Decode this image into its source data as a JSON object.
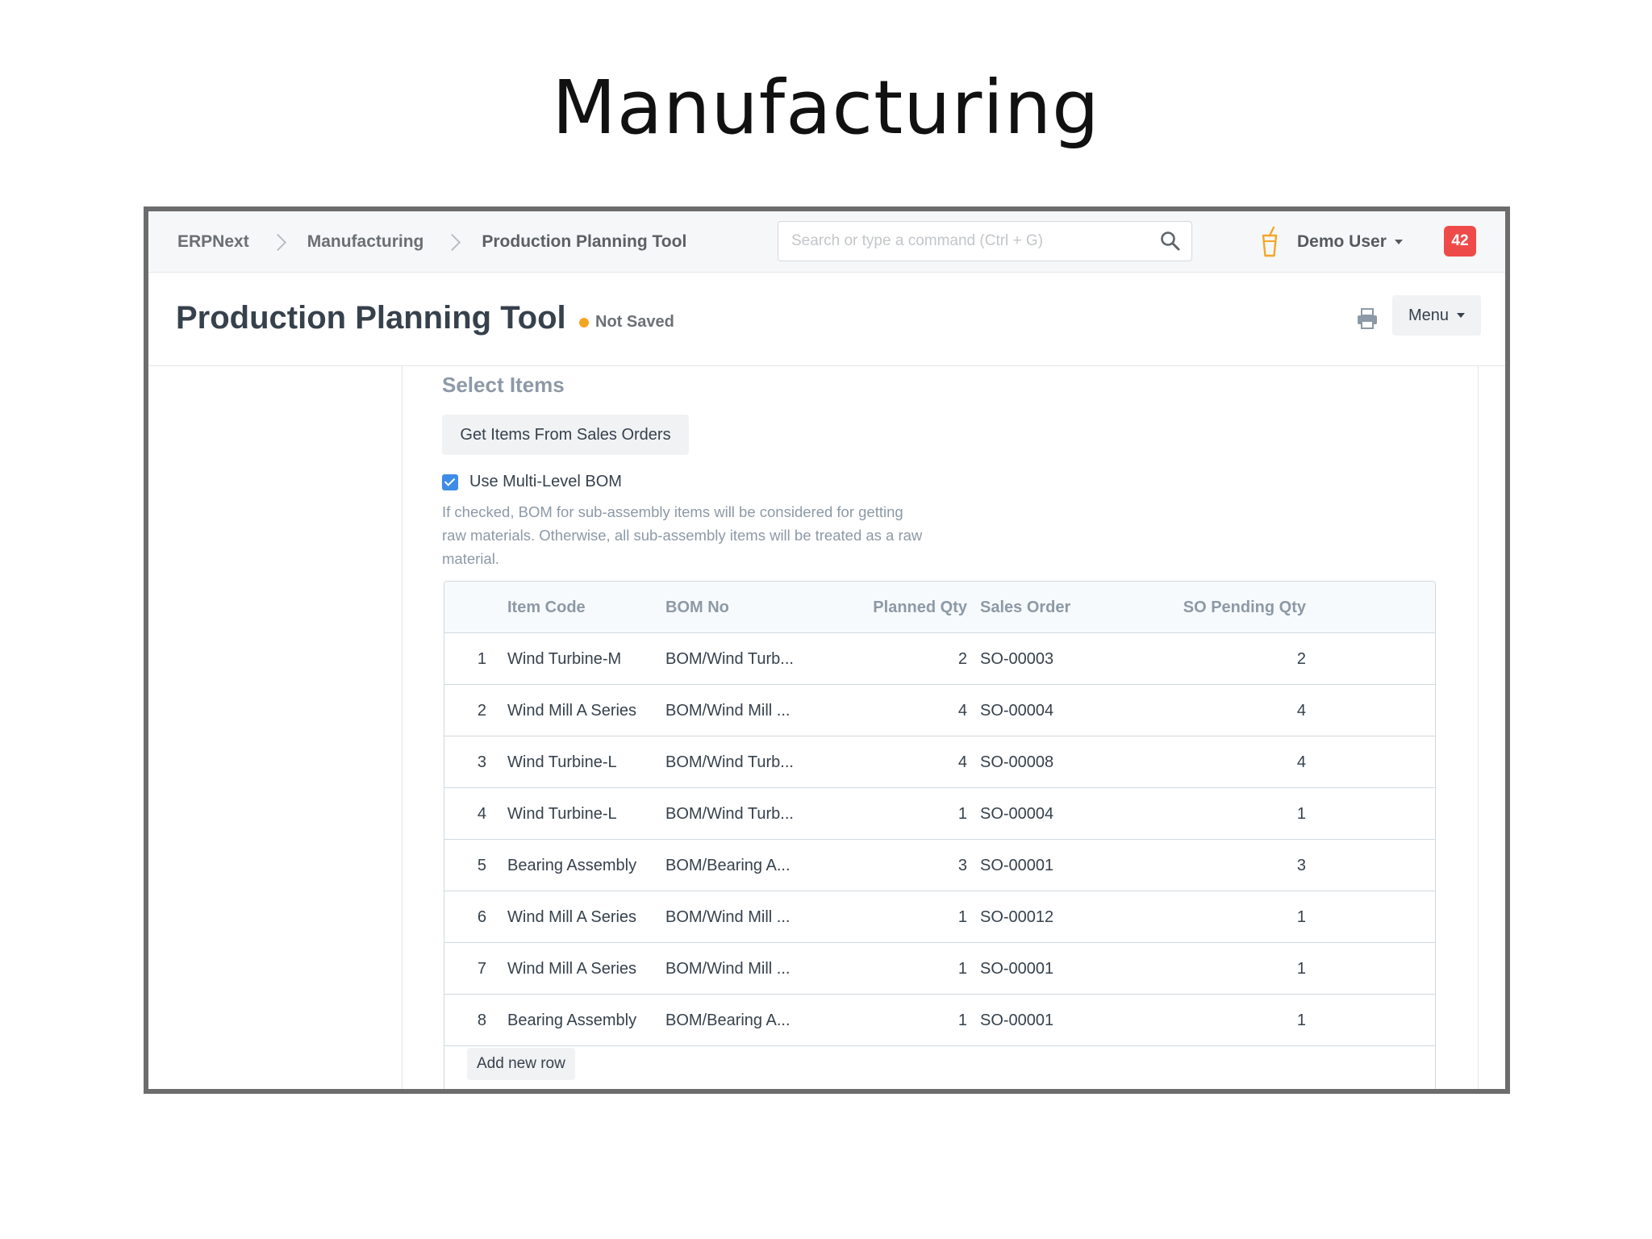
{
  "slide": {
    "title": "Manufacturing"
  },
  "navbar": {
    "breadcrumbs": [
      "ERPNext",
      "Manufacturing",
      "Production Planning Tool"
    ],
    "search_placeholder": "Search or type a command (Ctrl + G)",
    "user": "Demo User",
    "notification_count": "42"
  },
  "page": {
    "title": "Production Planning Tool",
    "status": "Not Saved",
    "status_color": "#f6a522",
    "menu_label": "Menu"
  },
  "section": {
    "title": "Select Items",
    "get_items_label": "Get Items From Sales Orders",
    "checkbox_label": "Use Multi-Level BOM",
    "checkbox_checked": true,
    "help_text": "If checked, BOM for sub-assembly items will be considered for getting raw materials. Otherwise, all sub-assembly items will be treated as a raw material."
  },
  "grid": {
    "columns": [
      "Item Code",
      "BOM No",
      "Planned Qty",
      "Sales Order",
      "SO Pending Qty"
    ],
    "rows": [
      {
        "idx": "1",
        "item": "Wind Turbine-M",
        "bom": "BOM/Wind Turb...",
        "qty": "2",
        "so": "SO-00003",
        "pending": "2"
      },
      {
        "idx": "2",
        "item": "Wind Mill A Series",
        "bom": "BOM/Wind Mill ...",
        "qty": "4",
        "so": "SO-00004",
        "pending": "4"
      },
      {
        "idx": "3",
        "item": "Wind Turbine-L",
        "bom": "BOM/Wind Turb...",
        "qty": "4",
        "so": "SO-00008",
        "pending": "4"
      },
      {
        "idx": "4",
        "item": "Wind Turbine-L",
        "bom": "BOM/Wind Turb...",
        "qty": "1",
        "so": "SO-00004",
        "pending": "1"
      },
      {
        "idx": "5",
        "item": "Bearing Assembly",
        "bom": "BOM/Bearing A...",
        "qty": "3",
        "so": "SO-00001",
        "pending": "3"
      },
      {
        "idx": "6",
        "item": "Wind Mill A Series",
        "bom": "BOM/Wind Mill ...",
        "qty": "1",
        "so": "SO-00012",
        "pending": "1"
      },
      {
        "idx": "7",
        "item": "Wind Mill A Series",
        "bom": "BOM/Wind Mill ...",
        "qty": "1",
        "so": "SO-00001",
        "pending": "1"
      },
      {
        "idx": "8",
        "item": "Bearing Assembly",
        "bom": "BOM/Bearing A...",
        "qty": "1",
        "so": "SO-00001",
        "pending": "1"
      }
    ],
    "add_row_label": "Add new row"
  },
  "icons": {
    "search": "search-icon",
    "notification_bolt": "bolt-icon",
    "print": "print-icon",
    "breadcrumb_separator": "chevron-right-icon",
    "dropdown": "caret-down-icon"
  }
}
